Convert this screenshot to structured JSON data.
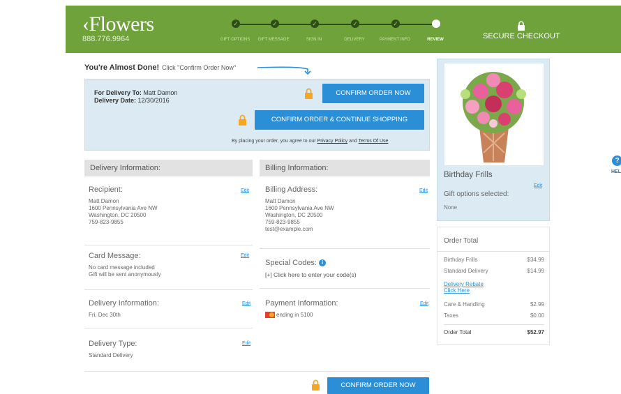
{
  "header": {
    "logo": "‹Flowers",
    "phone": "888.776.9964",
    "secure_label": "SECURE CHECKOUT",
    "brand_color": "#6fa23a",
    "steps": [
      {
        "label": "GIFT OPTIONS",
        "done": true
      },
      {
        "label": "GIFT MESSAGE",
        "done": true
      },
      {
        "label": "SIGN IN",
        "done": true
      },
      {
        "label": "DELIVERY",
        "done": true
      },
      {
        "label": "PAYMENT INFO",
        "done": true
      },
      {
        "label": "REVIEW",
        "done": false
      }
    ]
  },
  "almost": {
    "title": "You're Almost Done!",
    "subtitle": "Click \"Confirm Order Now\""
  },
  "confirm": {
    "delivery_to_label": "For Delivery To:",
    "delivery_to_value": "Matt Damon",
    "delivery_date_label": "Delivery Date:",
    "delivery_date_value": "12/30/2016",
    "confirm_now": "CONFIRM ORDER NOW",
    "confirm_continue": "CONFIRM ORDER & CONTINUE SHOPPING",
    "agree_prefix": "By placing your order, you agree to our",
    "privacy": "Privacy Policy",
    "and": "and",
    "terms": "Terms Of Use",
    "accent_color": "#2a8fd6"
  },
  "delivery": {
    "heading": "Delivery Information:",
    "recipient_title": "Recipient:",
    "recipient_lines": [
      "Matt Damon",
      "1600 Pennsylvania Ave NW",
      "Washington, DC 20500",
      "759-823-9855"
    ],
    "card_title": "Card Message:",
    "card_lines": [
      "No card message included",
      "Gift will be sent anonymously"
    ],
    "info_title": "Delivery Information:",
    "info_value": "Fri, Dec 30th",
    "type_title": "Delivery Type:",
    "type_value": "Standard Delivery",
    "edit": "Edit"
  },
  "billing": {
    "heading": "Billing Information:",
    "address_title": "Billing Address:",
    "address_lines": [
      "Matt Damon",
      "1600 Pennsylvania Ave NW",
      "Washington, DC 20500",
      "759-823-9855",
      "test@example.com"
    ],
    "codes_title": "Special Codes:",
    "codes_link": "[+] Click here to enter your code(s)",
    "payment_title": "Payment Information:",
    "payment_value": "ending in 5100",
    "edit": "Edit"
  },
  "product": {
    "name": "Birthday Frills",
    "gift_options": "Gift options selected:",
    "gift_value": "None",
    "edit": "Edit"
  },
  "order": {
    "title": "Order Total",
    "item_label": "Birthday Frills",
    "item_value": "$34.99",
    "delivery_label": "Standard Delivery",
    "delivery_value": "$14.99",
    "rebate_line1": "Delivery Rebate",
    "rebate_line2": "Click Here",
    "care_label": "Care & Handling",
    "care_value": "$2.99",
    "taxes_label": "Taxes",
    "taxes_value": "$0.00",
    "total_label": "Order Total",
    "total_value": "$52.97"
  },
  "bottom": {
    "confirm_now": "CONFIRM ORDER NOW"
  },
  "help": {
    "icon": "?",
    "label": "HEL"
  }
}
